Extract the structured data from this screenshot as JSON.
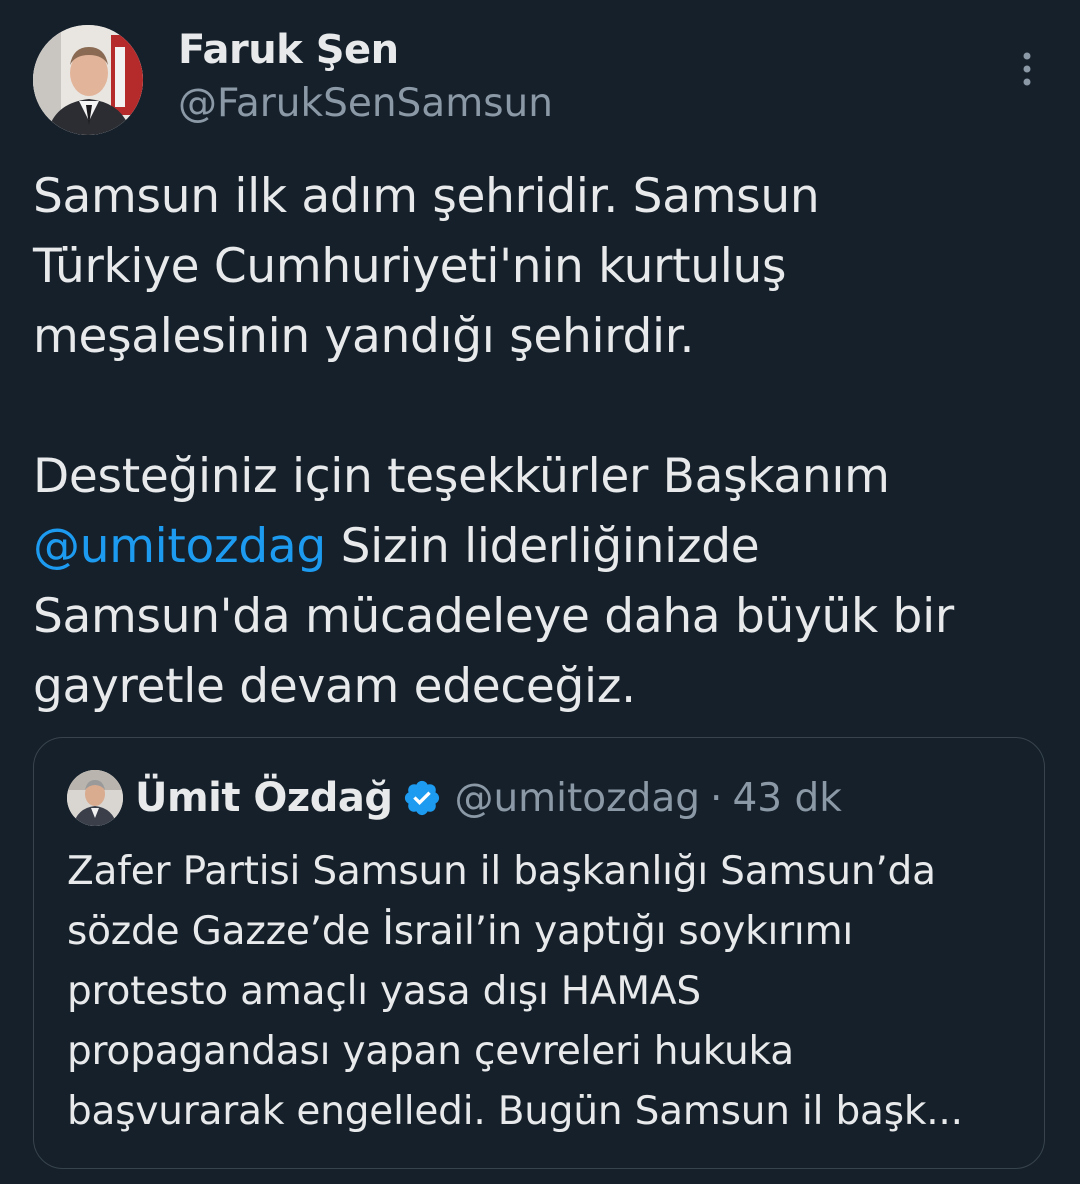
{
  "tweet": {
    "author_name": "Faruk Şen",
    "author_handle": "@FarukSenSamsun",
    "text_lines_1": [
      "Samsun ilk adım şehridir. Samsun",
      "Türkiye Cumhuriyeti'nin kurtuluş",
      "meşalesinin yandığı şehirdir."
    ],
    "text_line_4a": "Desteğiniz için teşekkürler Başkanım",
    "mention": "@umitozdag",
    "text_line_5b": " Sizin liderliğinizde",
    "text_line_6": "Samsun'da mücadeleye daha büyük bir",
    "text_line_7": "gayretle devam edeceğiz.",
    "more_icon": "more-vertical-icon"
  },
  "quote": {
    "author_name": "Ümit Özdağ",
    "author_handle": "@umitozdag",
    "separator": "·",
    "time": "43 dk",
    "verified_icon": "verified-badge-icon",
    "text_lines": [
      "Zafer Partisi Samsun il başkanlığı Samsun’da",
      "sözde Gazze’de İsrail’in yaptığı soykırımı",
      "protesto amaçlı yasa dışı HAMAS",
      "propagandası yapan çevreleri hukuka",
      "başvurarak engelledi. Bugün Samsun il başk..."
    ]
  },
  "colors": {
    "background": "#15202b",
    "text": "#e7e9ea",
    "secondary": "#8b98a5",
    "accent": "#1d9bf0",
    "border": "#38444d"
  }
}
